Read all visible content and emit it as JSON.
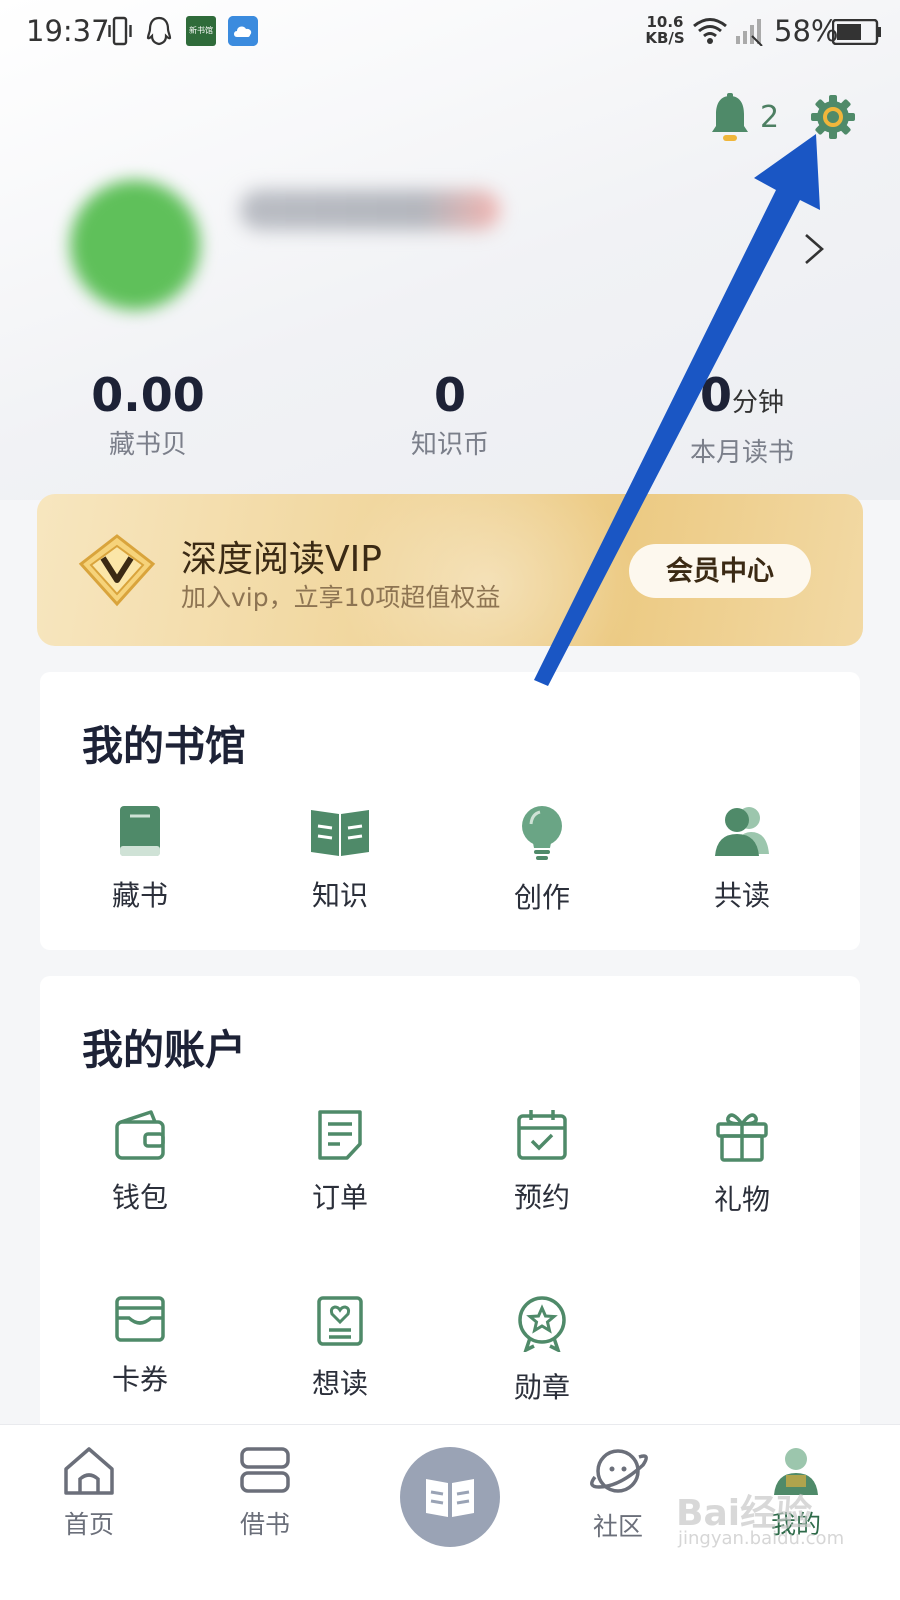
{
  "status_bar": {
    "time": "19:37",
    "net_speed_value": "10.6",
    "net_speed_unit": "KB/S",
    "battery": "58%",
    "app_icon_text": "新书馆"
  },
  "header": {
    "notification_count": "2",
    "icons": [
      "bell-icon",
      "gear-icon",
      "chevron-right-icon"
    ]
  },
  "stats": [
    {
      "value": "0.00",
      "unit": "",
      "label": "藏书贝"
    },
    {
      "value": "0",
      "unit": "",
      "label": "知识币"
    },
    {
      "value": "0",
      "unit": "分钟",
      "label": "本月读书"
    }
  ],
  "vip": {
    "title": "深度阅读VIP",
    "subtitle": "加入vip，立享10项超值权益",
    "button": "会员中心"
  },
  "library": {
    "title": "我的书馆",
    "items": [
      {
        "label": "藏书",
        "icon": "book-icon"
      },
      {
        "label": "知识",
        "icon": "open-book-icon"
      },
      {
        "label": "创作",
        "icon": "lightbulb-icon"
      },
      {
        "label": "共读",
        "icon": "group-icon"
      }
    ]
  },
  "account": {
    "title": "我的账户",
    "items": [
      {
        "label": "钱包",
        "icon": "wallet-icon"
      },
      {
        "label": "订单",
        "icon": "order-icon"
      },
      {
        "label": "预约",
        "icon": "calendar-check-icon"
      },
      {
        "label": "礼物",
        "icon": "gift-icon"
      },
      {
        "label": "卡券",
        "icon": "coupon-icon"
      },
      {
        "label": "想读",
        "icon": "wishlist-icon"
      },
      {
        "label": "勋章",
        "icon": "medal-icon"
      }
    ]
  },
  "tab_bar": {
    "tabs": [
      {
        "label": "首页",
        "icon": "home-icon"
      },
      {
        "label": "借书",
        "icon": "borrow-icon"
      },
      {
        "label": "",
        "icon": "read-book-icon"
      },
      {
        "label": "社区",
        "icon": "planet-icon"
      },
      {
        "label": "我的",
        "icon": "profile-icon"
      }
    ],
    "active": "我的"
  },
  "watermark": {
    "text": "Bai经验",
    "sub": "jingyan.baidu.com"
  },
  "colors": {
    "accent_green": "#4f8a69",
    "annotation_blue": "#1a56c4",
    "vip_gold": "#ecca83"
  }
}
